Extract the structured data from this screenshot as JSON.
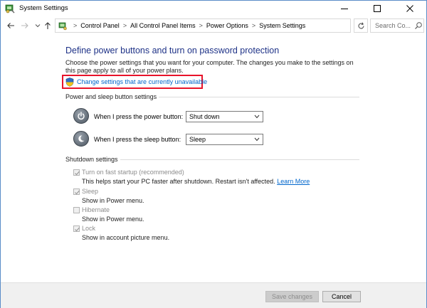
{
  "window": {
    "title": "System Settings",
    "controls": {
      "minimize": "—",
      "maximize": "☐",
      "close": "✕"
    }
  },
  "nav": {
    "breadcrumbs": [
      "Control Panel",
      "All Control Panel Items",
      "Power Options",
      "System Settings"
    ],
    "search_placeholder": "Search Co..."
  },
  "main": {
    "heading": "Define power buttons and turn on password protection",
    "description": "Choose the power settings that you want for your computer. The changes you make to the settings on this page apply to all of your power plans.",
    "change_link": "Change settings that are currently unavailable",
    "highlight_color": "#e8132a"
  },
  "power_section": {
    "title": "Power and sleep button settings",
    "rows": [
      {
        "label": "When I press the power button:",
        "value": "Shut down",
        "icon": "power-icon"
      },
      {
        "label": "When I press the sleep button:",
        "value": "Sleep",
        "icon": "moon-icon"
      }
    ]
  },
  "shutdown_section": {
    "title": "Shutdown settings",
    "options": [
      {
        "label": "Turn on fast startup (recommended)",
        "checked": true,
        "desc": "This helps start your PC faster after shutdown. Restart isn't affected.",
        "link": "Learn More"
      },
      {
        "label": "Sleep",
        "checked": true,
        "desc": "Show in Power menu."
      },
      {
        "label": "Hibernate",
        "checked": false,
        "desc": "Show in Power menu."
      },
      {
        "label": "Lock",
        "checked": true,
        "desc": "Show in account picture menu."
      }
    ]
  },
  "footer": {
    "save_label": "Save changes",
    "cancel_label": "Cancel"
  }
}
